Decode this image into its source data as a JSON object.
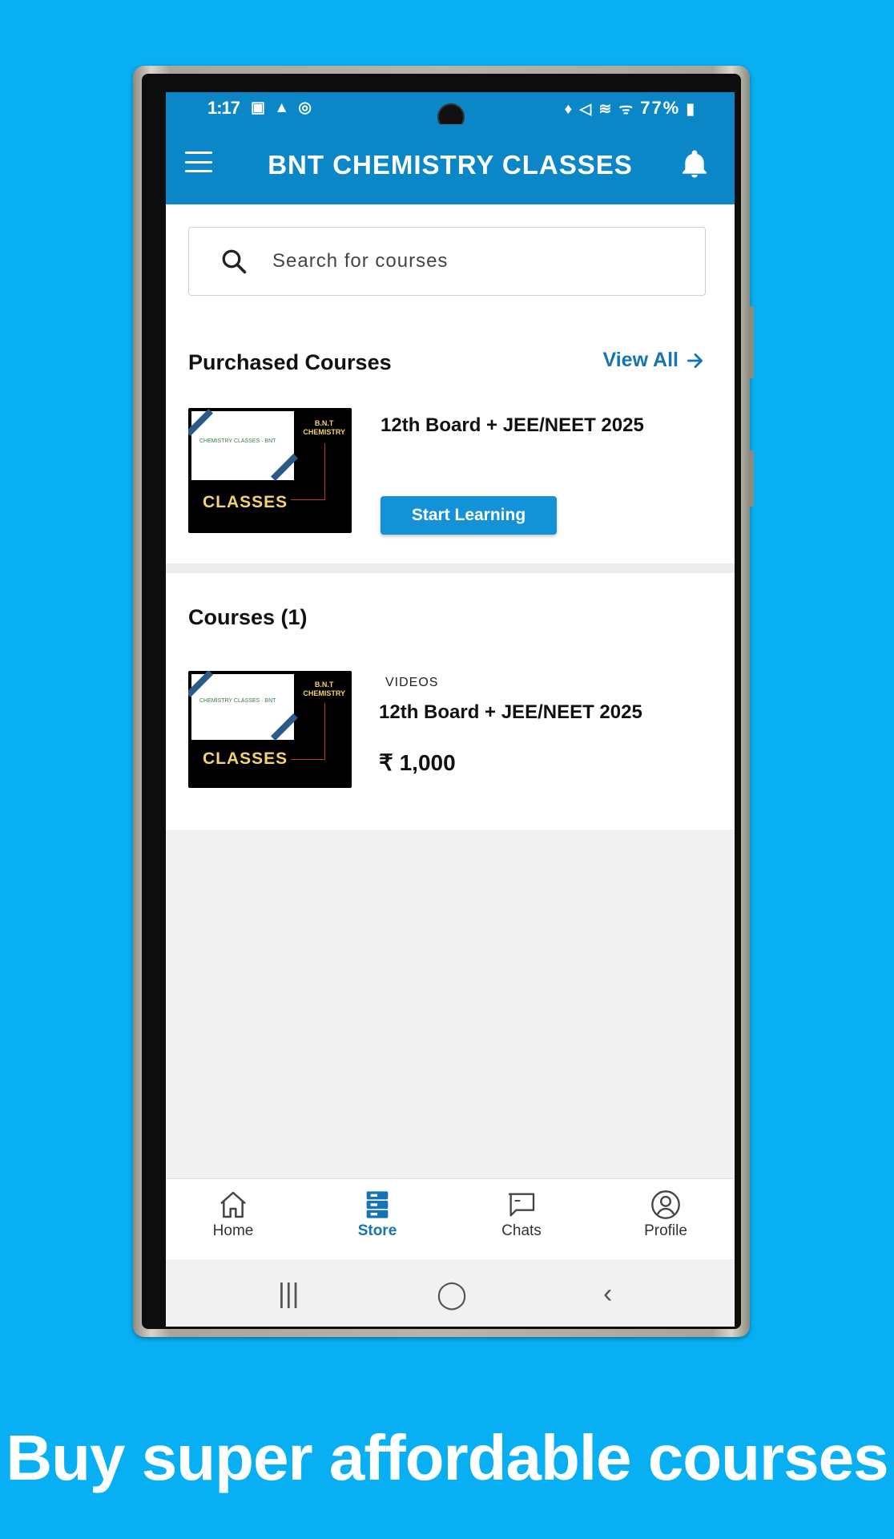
{
  "status_bar": {
    "time": "1:17",
    "left_icons": "▣ ▲ ◎",
    "right_icons": "♦ ◁ ≋ ᯤ",
    "battery": "77%"
  },
  "app_bar": {
    "title": "BNT CHEMISTRY CLASSES",
    "menu_icon": "hamburger-icon",
    "bell_icon": "bell-icon"
  },
  "search": {
    "placeholder": "Search for courses",
    "value": ""
  },
  "purchased": {
    "heading": "Purchased Courses",
    "view_all": "View All",
    "course": {
      "title": "12th Board + JEE/NEET 2025",
      "thumb_text": "CLASSES",
      "thumb_brand": "B.N.T",
      "thumb_brand2": "CHEMISTRY",
      "button": "Start Learning"
    }
  },
  "courses": {
    "heading": "Courses (1)",
    "items": [
      {
        "tag": "VIDEOS",
        "title": "12th Board + JEE/NEET 2025",
        "price": "₹ 1,000",
        "thumb_text": "CLASSES",
        "thumb_brand": "B.N.T",
        "thumb_brand2": "CHEMISTRY"
      }
    ]
  },
  "bottom_nav": {
    "items": [
      {
        "label": "Home",
        "icon": "home-icon",
        "active": false
      },
      {
        "label": "Store",
        "icon": "store-icon",
        "active": true
      },
      {
        "label": "Chats",
        "icon": "chat-icon",
        "active": false
      },
      {
        "label": "Profile",
        "icon": "profile-icon",
        "active": false
      }
    ]
  },
  "system_nav": {
    "recents": "|||",
    "home": "◯",
    "back": "‹"
  },
  "tagline": "Buy super affordable courses",
  "colors": {
    "background": "#08b0f3",
    "appbar": "#0b86c6",
    "accent": "#1474b4",
    "button": "#1392d8"
  }
}
